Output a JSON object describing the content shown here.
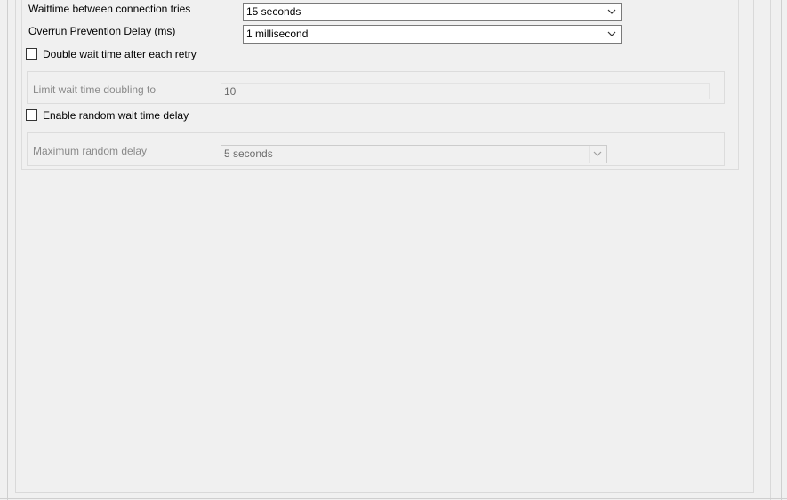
{
  "settings": {
    "waittime": {
      "label": "Waittime between connection tries",
      "value": "15 seconds"
    },
    "overrun": {
      "label": "Overrun Prevention Delay (ms)",
      "value": "1 millisecond"
    },
    "double_wait": {
      "label": "Double wait time after each retry",
      "checked": false
    },
    "limit_doubling": {
      "label": "Limit wait time doubling to",
      "value": "10",
      "enabled": false
    },
    "random_delay": {
      "label": "Enable random wait time delay",
      "checked": false
    },
    "max_random": {
      "label": "Maximum random delay",
      "value": "5 seconds",
      "enabled": false
    }
  },
  "icons": {
    "dropdown": "chevron-down-icon"
  },
  "colors": {
    "background": "#f0f0f0",
    "disabled_text": "#8a8a8a",
    "border": "#7a7a7a"
  }
}
